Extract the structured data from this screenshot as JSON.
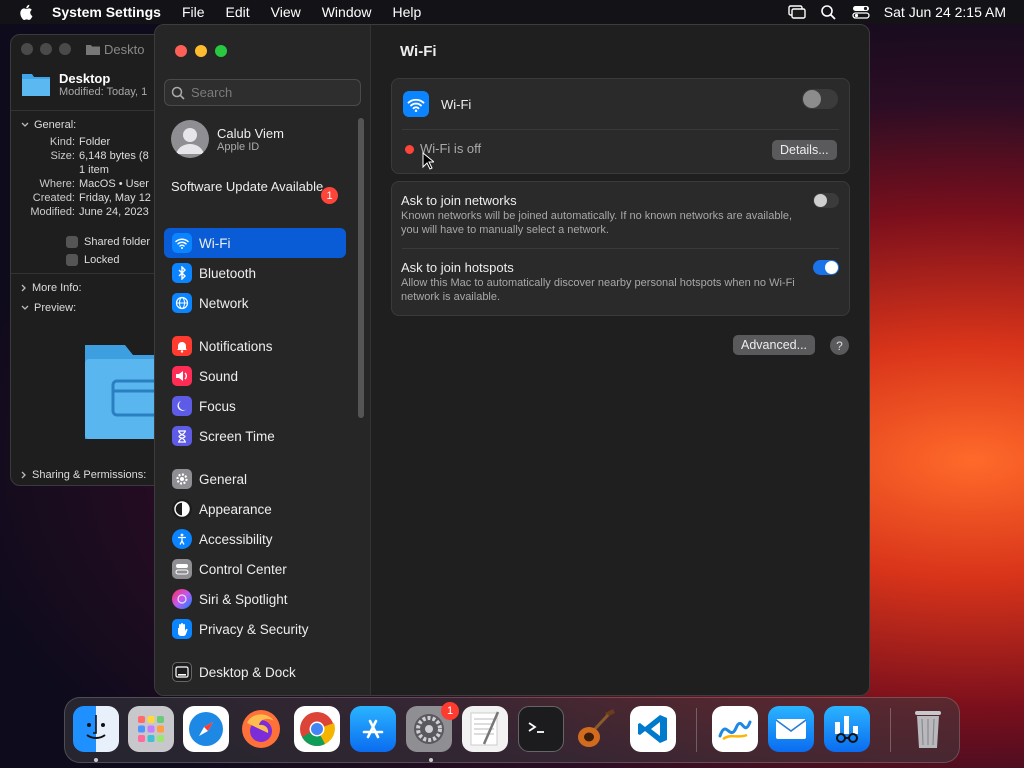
{
  "menubar": {
    "app_name": "System Settings",
    "items": [
      "File",
      "Edit",
      "View",
      "Window",
      "Help"
    ],
    "datetime": "Sat Jun 24  2:15 AM"
  },
  "info_window": {
    "title": "Deskto",
    "name": "Desktop",
    "modified_short": "Modified: Today, 1",
    "general_label": "General:",
    "fields": [
      {
        "k": "Kind:",
        "v": "Folder"
      },
      {
        "k": "Size:",
        "v": "6,148 bytes (8"
      },
      {
        "k": "",
        "v": "1 item"
      },
      {
        "k": "Where:",
        "v": "MacOS • User"
      },
      {
        "k": "Created:",
        "v": "Friday, May 12"
      },
      {
        "k": "Modified:",
        "v": "June 24, 2023"
      }
    ],
    "shared_label": "Shared folder",
    "locked_label": "Locked",
    "more_info_label": "More Info:",
    "preview_label": "Preview:",
    "sharing_label": "Sharing & Permissions:"
  },
  "sidebar": {
    "search_placeholder": "Search",
    "user": {
      "name": "Calub Viem",
      "sub": "Apple ID"
    },
    "software_update": {
      "label": "Software Update Available",
      "badge": "1"
    },
    "items": [
      {
        "label": "Wi-Fi",
        "icon": "wifi-icon",
        "color": "#0a84ff"
      },
      {
        "label": "Bluetooth",
        "icon": "bluetooth-icon",
        "color": "#0a84ff"
      },
      {
        "label": "Network",
        "icon": "globe-icon",
        "color": "#0a84ff"
      },
      {
        "label": "Notifications",
        "icon": "bell-icon",
        "color": "#ff3b30"
      },
      {
        "label": "Sound",
        "icon": "speaker-icon",
        "color": "#ff2d55"
      },
      {
        "label": "Focus",
        "icon": "moon-icon",
        "color": "#5e5ce6"
      },
      {
        "label": "Screen Time",
        "icon": "hourglass-icon",
        "color": "#5e5ce6"
      },
      {
        "label": "General",
        "icon": "gear-icon",
        "color": "#8e8e93"
      },
      {
        "label": "Appearance",
        "icon": "appearance-icon",
        "color": "#1c1c1e"
      },
      {
        "label": "Accessibility",
        "icon": "accessibility-icon",
        "color": "#0a84ff"
      },
      {
        "label": "Control Center",
        "icon": "control-center-icon",
        "color": "#8e8e93"
      },
      {
        "label": "Siri & Spotlight",
        "icon": "siri-icon",
        "color": "#bf5af2"
      },
      {
        "label": "Privacy & Security",
        "icon": "hand-icon",
        "color": "#0a84ff"
      },
      {
        "label": "Desktop & Dock",
        "icon": "dock-icon",
        "color": "#1c1c1e"
      }
    ]
  },
  "content": {
    "title": "Wi-Fi",
    "wifi_label": "Wi-Fi",
    "wifi_status": "Wi-Fi is off",
    "details_button": "Details...",
    "ask_networks_title": "Ask to join networks",
    "ask_networks_desc": "Known networks will be joined automatically. If no known networks are available, you will have to manually select a network.",
    "ask_hotspots_title": "Ask to join hotspots",
    "ask_hotspots_desc": "Allow this Mac to automatically discover nearby personal hotspots when no Wi-Fi network is available.",
    "advanced_button": "Advanced...",
    "help_button": "?",
    "wifi_on": false,
    "ask_networks_on": false,
    "ask_hotspots_on": true
  },
  "dock": {
    "settings_badge": "1",
    "apps": [
      "finder-icon",
      "launchpad-icon",
      "safari-icon",
      "firefox-icon",
      "chrome-icon",
      "app-store-icon",
      "system-settings-icon",
      "textedit-icon",
      "terminal-icon",
      "garageband-icon",
      "vscode-icon",
      "freeform-icon",
      "mail-icon",
      "preview-app-icon",
      "trash-icon"
    ]
  },
  "colors": {
    "accent": "#0a5bd6",
    "status_off": "#ff453a",
    "toggle_on": "#1a73e8"
  }
}
